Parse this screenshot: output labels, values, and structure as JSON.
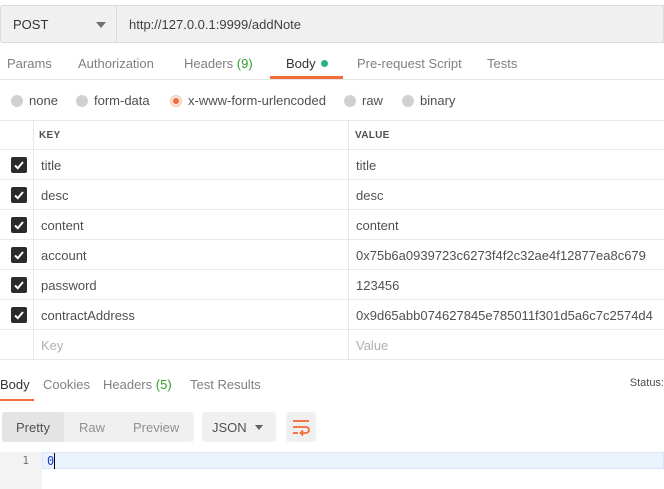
{
  "request": {
    "method": "POST",
    "url": "http://127.0.0.1:9999/addNote"
  },
  "request_tabs": [
    {
      "label": "Params"
    },
    {
      "label": "Authorization"
    },
    {
      "label": "Headers",
      "count": "(9)"
    },
    {
      "label": "Body"
    },
    {
      "label": "Pre-request Script"
    },
    {
      "label": "Tests"
    }
  ],
  "body_types": [
    {
      "label": "none",
      "selected": false
    },
    {
      "label": "form-data",
      "selected": false
    },
    {
      "label": "x-www-form-urlencoded",
      "selected": true
    },
    {
      "label": "raw",
      "selected": false
    },
    {
      "label": "binary",
      "selected": false
    }
  ],
  "params_table": {
    "headers": {
      "key": "KEY",
      "value": "VALUE"
    },
    "rows": [
      {
        "key": "title",
        "value": "title",
        "checked": true
      },
      {
        "key": "desc",
        "value": "desc",
        "checked": true
      },
      {
        "key": "content",
        "value": "content",
        "checked": true
      },
      {
        "key": "account",
        "value": "0x75b6a0939723c6273f4f2c32ae4f12877ea8c679",
        "checked": true
      },
      {
        "key": "password",
        "value": "123456",
        "checked": true
      },
      {
        "key": "contractAddress",
        "value": "0x9d65abb074627845e785011f301d5a6c7c2574d4",
        "checked": true
      }
    ],
    "new_row": {
      "key_placeholder": "Key",
      "value_placeholder": "Value"
    }
  },
  "response_tabs": [
    {
      "label": "Body"
    },
    {
      "label": "Cookies"
    },
    {
      "label": "Headers",
      "count": "(5)"
    },
    {
      "label": "Test Results"
    }
  ],
  "response_status_label": "Status:",
  "view_modes": [
    "Pretty",
    "Raw",
    "Preview"
  ],
  "format": "JSON",
  "editor": {
    "line_number": "1",
    "content": "0"
  },
  "colors": {
    "accent": "#f26b3a",
    "count_green": "#2ca02c",
    "body_dot": "#26b47f"
  }
}
